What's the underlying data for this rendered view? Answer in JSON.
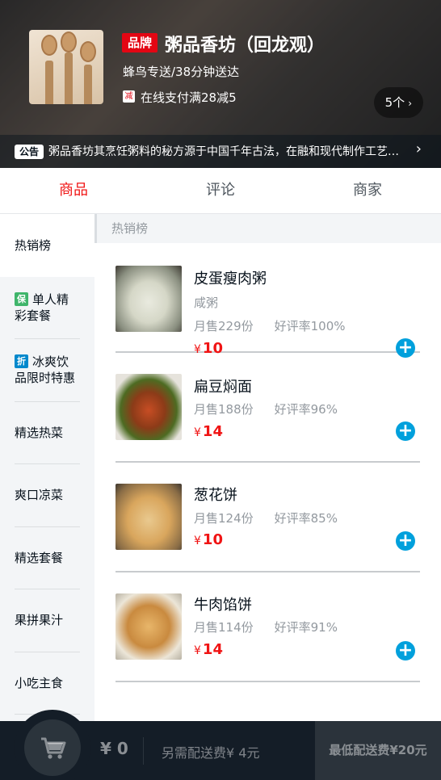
{
  "seller": {
    "brand_badge": "品牌",
    "name": "粥品香坊（回龙观）",
    "delivery": "蜂鸟专送/38分钟送达",
    "support_icon": "减",
    "support_text": "在线支付满28减5",
    "support_count": "5个",
    "bulletin_tag": "公告",
    "bulletin": "粥品香坊其烹饪粥料的秘方源于中国千年古法，在融和现代制作工艺，由世界烹饪大师屈浩先生领衔研发。"
  },
  "tabs": [
    {
      "label": "商品",
      "active": true
    },
    {
      "label": "评论",
      "active": false
    },
    {
      "label": "商家",
      "active": false
    }
  ],
  "menu": [
    {
      "badge": "",
      "label": "热销榜"
    },
    {
      "badge": "保",
      "label": "单人精彩套餐"
    },
    {
      "badge": "折",
      "label": "冰爽饮品限时特惠"
    },
    {
      "badge": "",
      "label": "精选热菜"
    },
    {
      "badge": "",
      "label": "爽口凉菜"
    },
    {
      "badge": "",
      "label": "精选套餐"
    },
    {
      "badge": "",
      "label": "果拼果汁"
    },
    {
      "badge": "",
      "label": "小吃主食"
    }
  ],
  "section_title": "热销榜",
  "foods": [
    {
      "name": "皮蛋瘦肉粥",
      "description": "咸粥",
      "sell": "月售229份",
      "rating": "好评率100%",
      "currency": "¥",
      "price": "10"
    },
    {
      "name": "扁豆焖面",
      "description": "",
      "sell": "月售188份",
      "rating": "好评率96%",
      "currency": "¥",
      "price": "14"
    },
    {
      "name": "葱花饼",
      "description": "",
      "sell": "月售124份",
      "rating": "好评率85%",
      "currency": "¥",
      "price": "10"
    },
    {
      "name": "牛肉馅饼",
      "description": "",
      "sell": "月售114份",
      "rating": "好评率91%",
      "currency": "¥",
      "price": "14"
    }
  ],
  "cart": {
    "total": "¥ 0",
    "delivery_fee": "另需配送费¥ 4元",
    "min_price": "最低配送费¥20元"
  },
  "colors": {
    "accent": "#f01414",
    "add_button": "#00a0dc",
    "cart_bg": "#141d27"
  },
  "icons": {
    "cart": "cart-icon",
    "add": "add-circle-icon",
    "chevron": "chevron-right-icon"
  }
}
